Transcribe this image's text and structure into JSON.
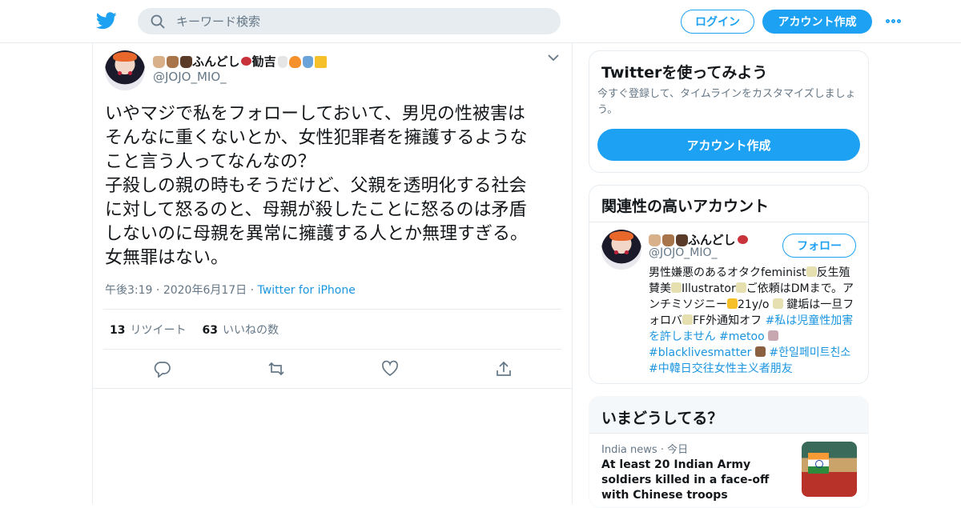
{
  "header": {
    "search_placeholder": "キーワード検索",
    "login_label": "ログイン",
    "signup_label": "アカウント作成"
  },
  "tweet": {
    "author_name": "ふんどし",
    "author_name_suffix": "勧吉",
    "author_handle": "@JOJO_MIO_",
    "text": "いやマジで私をフォローしておいて、男児の性被害は\nそんなに重くないとか、女性犯罪者を擁護するような\nこと言う人ってなんなの？\n子殺しの親の時もそうだけど、父親を透明化する社会\nに対して怒るのと、母親が殺したことに怒るのは矛盾\nしないのに母親を異常に擁護する人とか無理すぎる。\n女無罪はない。",
    "time": "午後3:19",
    "date": "2020年6月17日",
    "source": "Twitter for iPhone",
    "retweets_count": "13",
    "retweets_label": "リツイート",
    "likes_count": "63",
    "likes_label": "いいねの数"
  },
  "sidebar": {
    "signup_card": {
      "title": "Twitterを使ってみよう",
      "description": "今すぐ登録して、タイムラインをカスタマイズしましょう。",
      "button_label": "アカウント作成"
    },
    "related": {
      "title": "関連性の高いアカウント",
      "name": "ふんどし",
      "handle": "@JOJO_MIO_",
      "follow_label": "フォロー",
      "bio_1": "男性嫌悪のあるオタクfeminist",
      "bio_2": "反生殖賛美",
      "bio_3": "Illustrator",
      "bio_4": "ご依頼はDMまで。アンチミソジニー",
      "bio_5": "21y/o ",
      "bio_6": "鍵垢は一旦フォロバ",
      "bio_7": "FF外通知オフ ",
      "tag_1": "#私は児童性加害を許しません",
      "tag_2": "#metoo",
      "tag_3": "#blacklivesmatter",
      "tag_4": "#한일페미트친소",
      "tag_5": "#中韓日交往女性主义者朋友"
    },
    "trends": {
      "title": "いまどうしてる？",
      "news_source": "India news",
      "news_time": "今日",
      "news_title": "At least 20 Indian Army soldiers killed in a face-off with Chinese troops"
    }
  },
  "colors": {
    "accent": "#1da1f2",
    "link": "#1b95e0",
    "muted": "#657786",
    "border": "#e6ecf0"
  }
}
